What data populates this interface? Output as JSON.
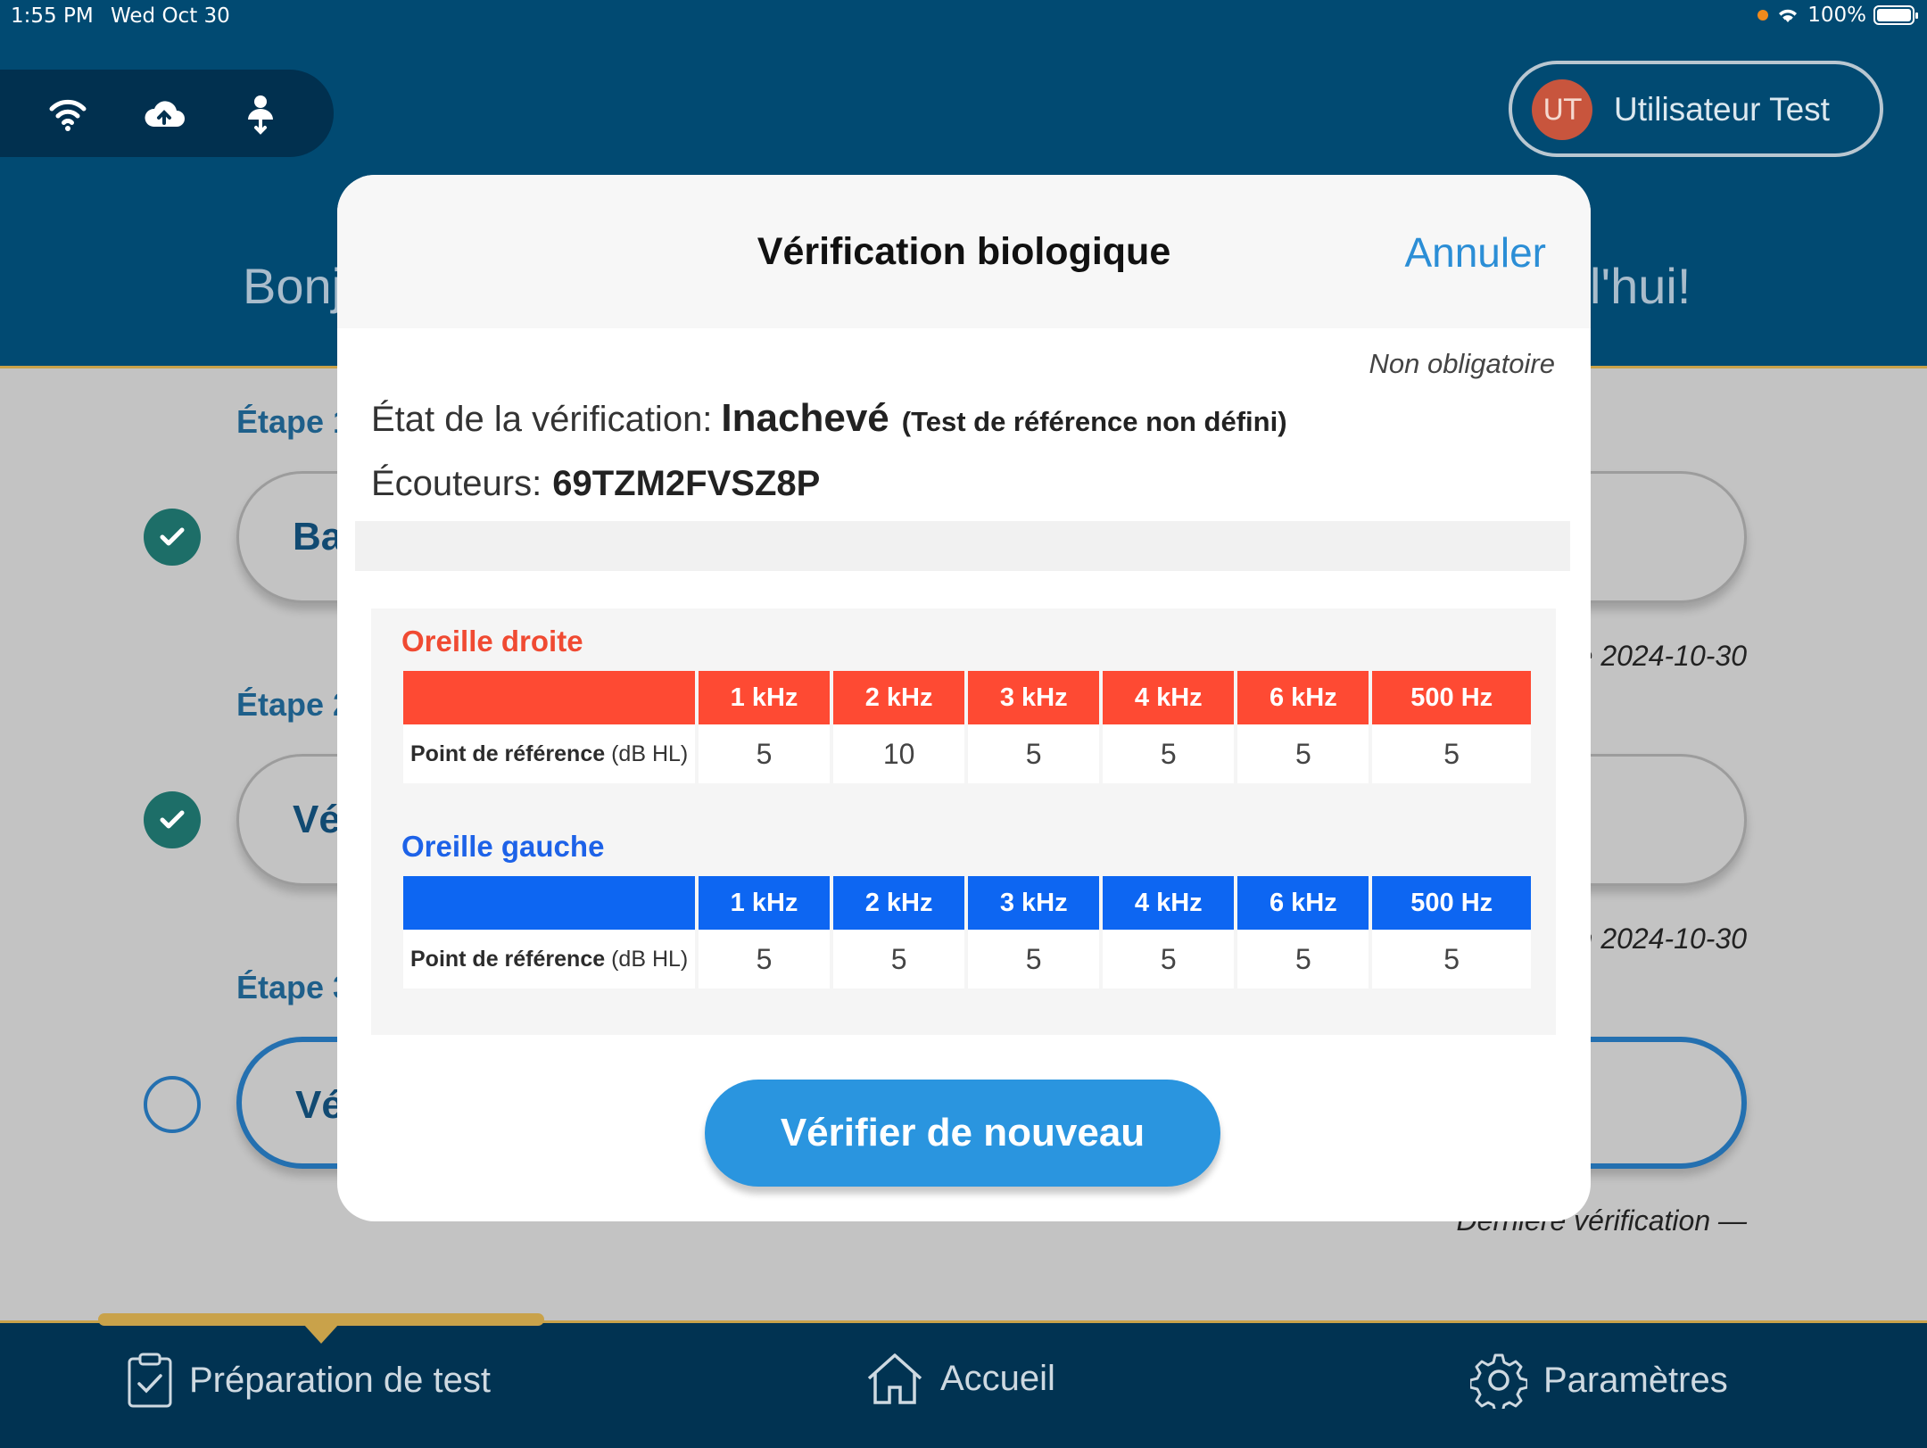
{
  "status_bar": {
    "time": "1:55 PM",
    "date": "Wed Oct 30",
    "battery": "100%"
  },
  "user": {
    "initials": "UT",
    "name": "Utilisateur Test"
  },
  "greeting": {
    "left_fragment": "Bonj",
    "right_fragment": "l'hui!"
  },
  "steps": [
    {
      "label": "Étape 1",
      "button": "Ba",
      "done": true,
      "last_check": "e 2024-10-30"
    },
    {
      "label": "Étape 2",
      "button": "Vé",
      "done": true,
      "last_check": "n 2024-10-30"
    },
    {
      "label": "Étape 3",
      "button": "Vé",
      "done": false,
      "last_check": "Dernière vérification  —"
    }
  ],
  "tabs": {
    "prep": "Préparation de test",
    "home": "Accueil",
    "settings": "Paramètres"
  },
  "modal": {
    "title": "Vérification biologique",
    "cancel": "Annuler",
    "optional": "Non obligatoire",
    "status_label": "État de la vérification:",
    "status_value": "Inachevé",
    "status_note": "(Test de référence non défini)",
    "headphones_label": "Écouteurs:",
    "headphones_value": "69TZM2FVSZ8P",
    "retry_button": "Vérifier de nouveau"
  },
  "ears": {
    "row_label": "Point de référence",
    "row_unit": "(dB HL)",
    "frequencies": [
      "1 kHz",
      "2 kHz",
      "3 kHz",
      "4 kHz",
      "6 kHz",
      "500 Hz"
    ],
    "right": {
      "title": "Oreille droite",
      "values": [
        "5",
        "10",
        "5",
        "5",
        "5",
        "5"
      ]
    },
    "left": {
      "title": "Oreille gauche",
      "values": [
        "5",
        "5",
        "5",
        "5",
        "5",
        "5"
      ]
    }
  },
  "colors": {
    "header": "#014a72",
    "right_ear": "#fe4a33",
    "left_ear": "#0d66f2",
    "accent": "#2a95df",
    "gold": "#c9a24a"
  }
}
